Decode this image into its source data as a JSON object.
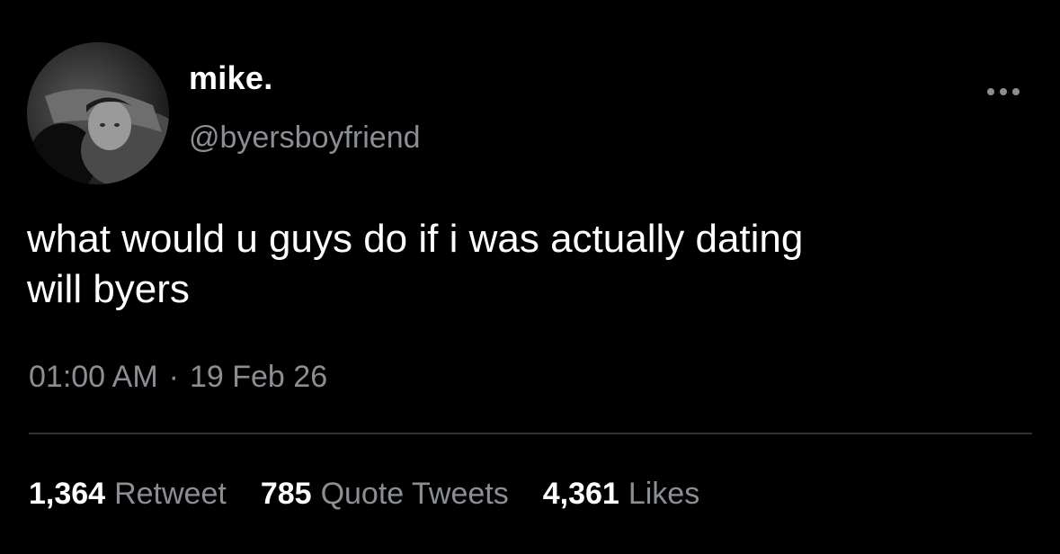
{
  "author": {
    "display_name": "mike.",
    "handle": "@byersboyfriend"
  },
  "tweet": {
    "text": "what would u guys do if i was actually dating\nwill byers",
    "time": "01:00 AM",
    "separator": "·",
    "date": "19 Feb 26"
  },
  "stats": {
    "retweets": {
      "count": "1,364",
      "label": "Retweet"
    },
    "quotes": {
      "count": "785",
      "label": "Quote Tweets"
    },
    "likes": {
      "count": "4,361",
      "label": "Likes"
    }
  },
  "icons": {
    "more": "more-horizontal-icon"
  },
  "colors": {
    "background": "#000000",
    "primary_text": "#ffffff",
    "secondary_text": "#8b8f94",
    "divider": "#2f3336"
  }
}
